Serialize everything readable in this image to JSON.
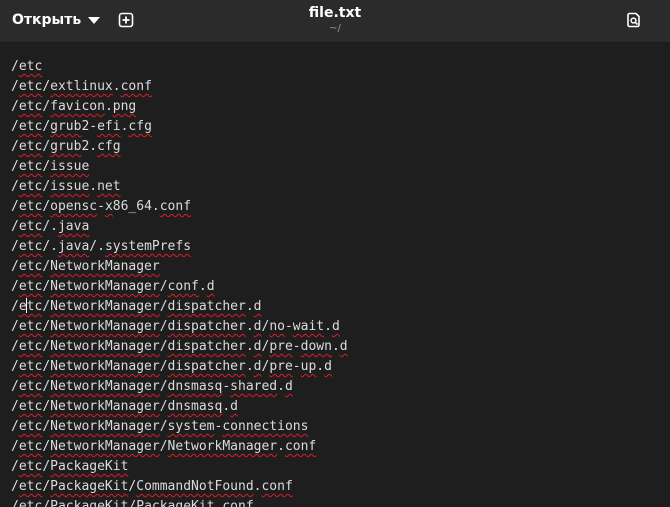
{
  "header": {
    "open_label": "Открыть",
    "title": "file.txt",
    "subtitle": "~/"
  },
  "icons": {
    "open_dropdown": "chevron-down-icon",
    "new_tab": "new-tab-icon",
    "save": "save-document-icon"
  },
  "editor": {
    "lines": [
      "/etc",
      "/etc/extlinux.conf",
      "/etc/favicon.png",
      "/etc/grub2-efi.cfg",
      "/etc/grub2.cfg",
      "/etc/issue",
      "/etc/issue.net",
      "/etc/opensc-x86_64.conf",
      "/etc/.java",
      "/etc/.java/.systemPrefs",
      "/etc/NetworkManager",
      "/etc/NetworkManager/conf.d",
      "/etc/NetworkManager/dispatcher.d",
      "/etc/NetworkManager/dispatcher.d/no-wait.d",
      "/etc/NetworkManager/dispatcher.d/pre-down.d",
      "/etc/NetworkManager/dispatcher.d/pre-up.d",
      "/etc/NetworkManager/dnsmasq-shared.d",
      "/etc/NetworkManager/dnsmasq.d",
      "/etc/NetworkManager/system-connections",
      "/etc/NetworkManager/NetworkManager.conf",
      "/etc/PackageKit",
      "/etc/PackageKit/CommandNotFound.conf",
      "/etc/PackageKit/PackageKit.conf"
    ]
  },
  "colors": {
    "background": "#1e1e1e",
    "headerbar": "#2b2b2b",
    "text": "#dcdcdc",
    "spellcheck": "#e01b24"
  }
}
